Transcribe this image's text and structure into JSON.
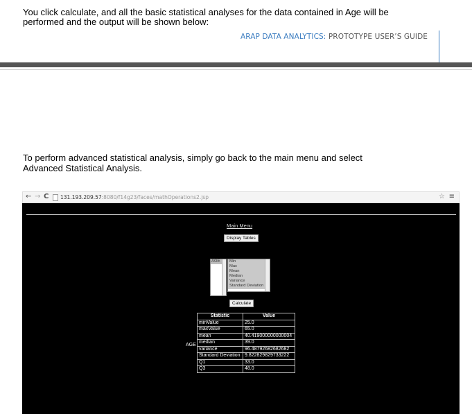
{
  "intro_text_line1": "You click calculate, and all the basic statistical analyses for the data contained in Age will be",
  "intro_text_line2": "performed and the output will be shown below:",
  "header": {
    "guide_accent": "ARAP DATA ANALYTICS:",
    "guide_rest": " PROTOTYPE USER’S GUIDE",
    "accent_color": "#3a7cc0"
  },
  "advanced_text_line1": "To perform advanced statistical analysis, simply go back to the main menu and select",
  "advanced_text_line2": "Advanced Statistical Analysis.",
  "browser": {
    "back": "←",
    "forward": "→",
    "reload": "C",
    "url_host": "131.193.209.57",
    "url_path": ":8080/f14g23/faces/mathOperations2.jsp",
    "star": "☆",
    "menu": "≡"
  },
  "app": {
    "main_menu_link": "Main Menu",
    "display_tables_button": "Display Tables",
    "column_options": [
      "AGE"
    ],
    "stat_options": [
      "Min",
      "Max",
      "Mean",
      "Median",
      "Variance",
      "Standard Deviation"
    ],
    "calculate_button": "Calculate",
    "row_label": "AGE",
    "results_header": {
      "statistic": "Statistic",
      "value": "Value"
    },
    "results": [
      {
        "statistic": "minValue",
        "value": "25.0"
      },
      {
        "statistic": "maxValue",
        "value": "65.0"
      },
      {
        "statistic": "mean",
        "value": "40.419000000000004"
      },
      {
        "statistic": "median",
        "value": "39.0"
      },
      {
        "statistic": "variance",
        "value": "96.48792682682682"
      },
      {
        "statistic": "Standard Deviation",
        "value": "9.822829829733222"
      },
      {
        "statistic": "Q1",
        "value": "33.0"
      },
      {
        "statistic": "Q3",
        "value": "48.0"
      }
    ]
  }
}
